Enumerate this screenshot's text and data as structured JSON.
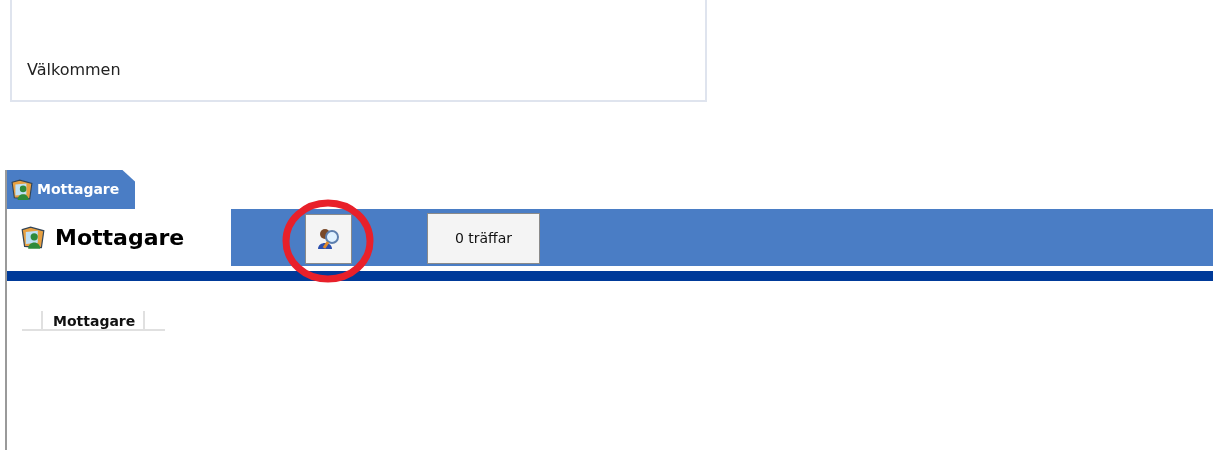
{
  "welcome_panel": {
    "text": "Välkommen"
  },
  "tabs": [
    {
      "label": "Mottagare",
      "selected": true
    }
  ],
  "toolbar": {
    "title": "Mottagare",
    "search_button": {
      "circled": true
    },
    "hits_button": {
      "label": "0 träffar"
    }
  },
  "table": {
    "columns": [
      "Mottagare"
    ]
  }
}
